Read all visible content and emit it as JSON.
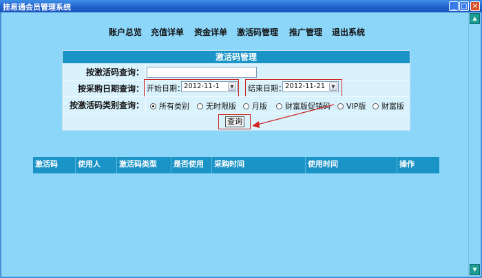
{
  "window": {
    "title": "挂易通会员管理系统",
    "min_icon": "minimize-icon",
    "max_icon": "maximize-icon",
    "close_icon": "close-icon"
  },
  "nav": {
    "items": [
      "账户总览",
      "充值详单",
      "资金详单",
      "激活码管理",
      "推广管理",
      "退出系统"
    ]
  },
  "panel": {
    "title": "激活码管理",
    "code_query_label": "按激活码查询：",
    "code_query_value": "",
    "date_label": "按采购日期查询：",
    "start_label": "开始日期：",
    "start_value": "2012-11-1",
    "end_label": "结束日期：",
    "end_value": "2012-11-21",
    "type_label": "按激活码类别查询：",
    "type_options": [
      "所有类别",
      "无时限版",
      "月版",
      "财富版促销码",
      "VIP版",
      "财富版"
    ],
    "type_selected": 0,
    "query_button": "查询"
  },
  "table": {
    "headers": [
      "激活码",
      "使用人",
      "激活码类型",
      "是否使用",
      "采购时间",
      "使用时间",
      "操作"
    ]
  },
  "colors": {
    "titlebar": "#1f5fcc",
    "client_bg": "#8cd6fa",
    "header_bg": "#1a93c6",
    "annotation": "#d02020"
  }
}
